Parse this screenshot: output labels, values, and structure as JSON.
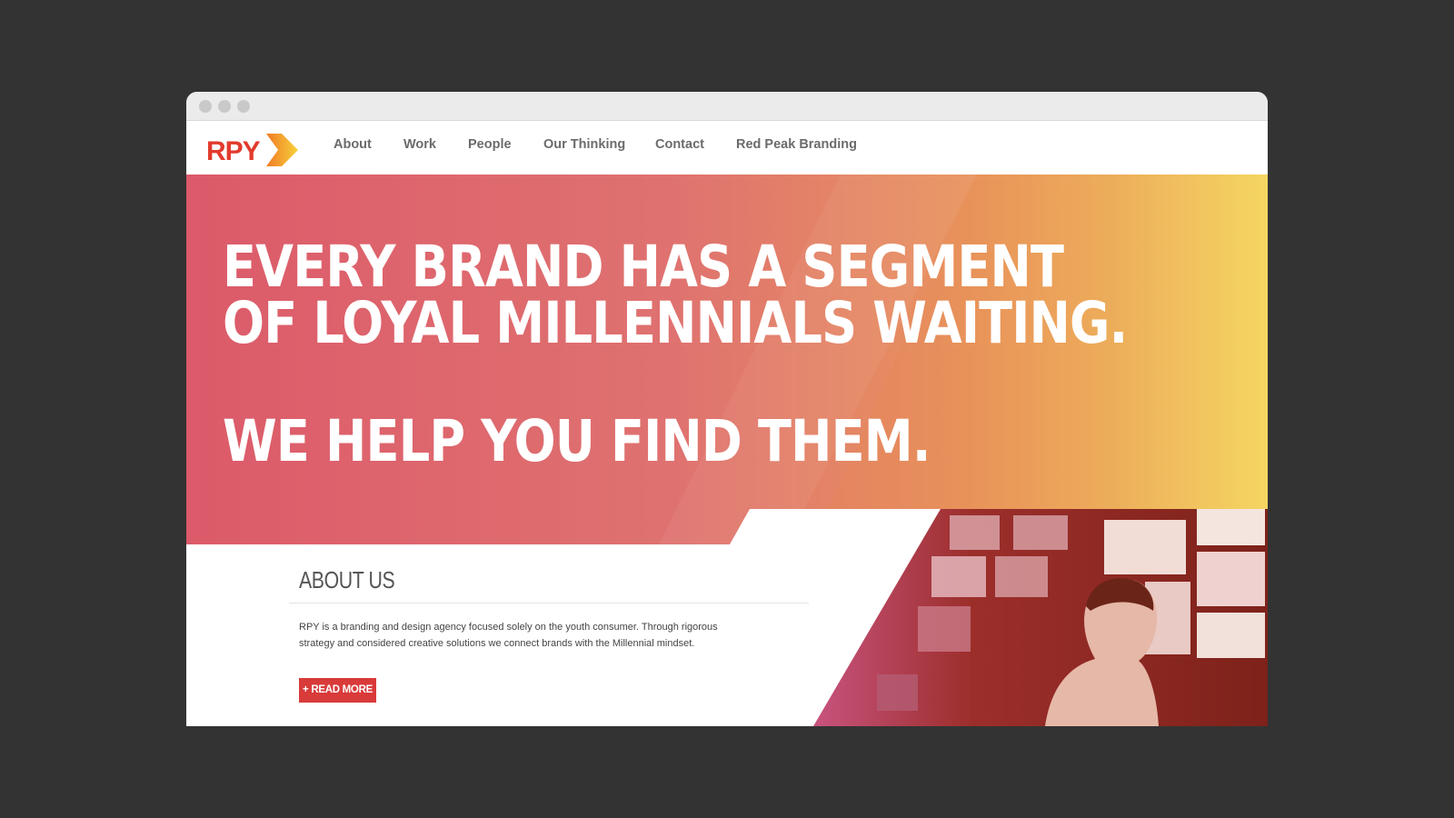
{
  "logo": {
    "text": "RPY"
  },
  "nav": {
    "items": [
      {
        "label": "About"
      },
      {
        "label": "Work"
      },
      {
        "label": "People"
      },
      {
        "label": "Our Thinking"
      },
      {
        "label": "Contact"
      },
      {
        "label": "Red Peak Branding"
      }
    ]
  },
  "hero": {
    "line1": "EVERY BRAND HAS A SEGMENT",
    "line2": "OF LOYAL MILLENNIALS WAITING.",
    "line3": "WE HELP YOU FIND THEM."
  },
  "about": {
    "title": "ABOUT US",
    "body": "RPY is a branding and design agency focused solely on the youth consumer. Through rigorous strategy and considered creative solutions we connect brands with the Millennial mindset.",
    "button_label": "+ READ MORE"
  },
  "colors": {
    "background": "#333333",
    "hero_gradient_start": "#dc5a6a",
    "hero_gradient_mid": "#e3825e",
    "hero_gradient_end": "#f6de66",
    "brand_red": "#d93a3a",
    "photo_tint": "#8a2a1e"
  },
  "icons": {
    "logo_arrow": "arrow-right-icon",
    "window_controls": [
      "window-dot-icon",
      "window-dot-icon",
      "window-dot-icon"
    ]
  }
}
